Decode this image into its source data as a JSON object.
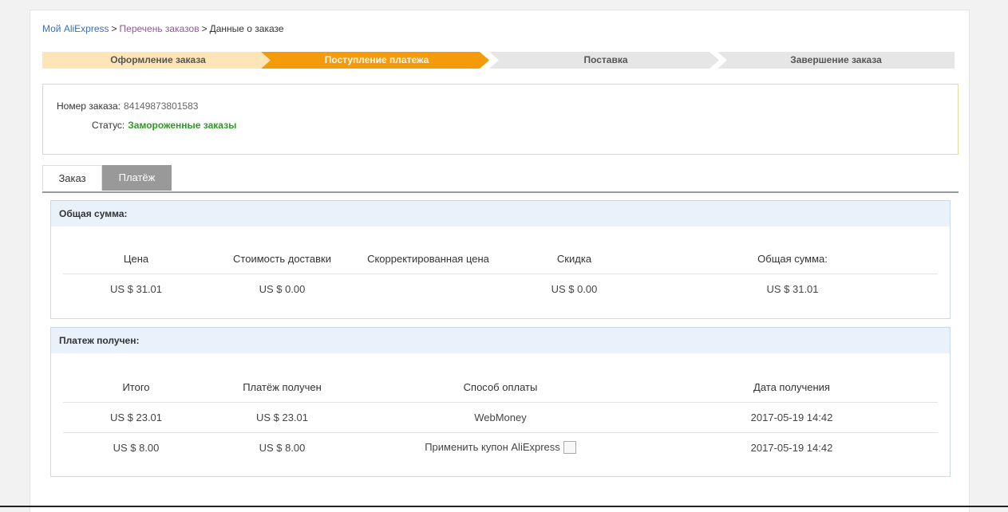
{
  "breadcrumb": {
    "items": [
      "Мой AliExpress",
      "Перечень заказов",
      "Данные о заказе"
    ],
    "separator": ">"
  },
  "steps": [
    {
      "label": "Оформление заказа",
      "state": "done",
      "color": "#fde5b8"
    },
    {
      "label": "Поступление платежа",
      "state": "active",
      "color": "#f59a0b"
    },
    {
      "label": "Поставка",
      "state": "pending",
      "color": "#e6e6e6"
    },
    {
      "label": "Завершение заказа",
      "state": "pending",
      "color": "#e6e6e6"
    }
  ],
  "order": {
    "number_label": "Номер заказа:",
    "number": "84149873801583",
    "status_label": "Статус:",
    "status": "Замороженные заказы",
    "status_color": "#2a9a20"
  },
  "tabs": [
    {
      "label": "Заказ",
      "active": false
    },
    {
      "label": "Платёж",
      "active": true
    }
  ],
  "total_panel": {
    "title": "Общая сумма:",
    "headers": [
      "Цена",
      "Стоимость доставки",
      "Скорректированная цена",
      "Скидка",
      "Общая сумма:"
    ],
    "rows": [
      [
        "US $ 31.01",
        "US $ 0.00",
        "",
        "US $ 0.00",
        "US $ 31.01"
      ]
    ]
  },
  "payment_panel": {
    "title": "Платеж получен:",
    "headers": [
      "Итого",
      "Платёж получен",
      "Способ оплаты",
      "Дата получения"
    ],
    "rows": [
      [
        "US $ 23.01",
        "US $ 23.01",
        "WebMoney",
        "2017-05-19 14:42"
      ],
      [
        "US $ 8.00",
        "US $ 8.00",
        "Применить купон AliExpress",
        "2017-05-19 14:42"
      ]
    ],
    "coupon_icon": "broken-image-icon"
  }
}
